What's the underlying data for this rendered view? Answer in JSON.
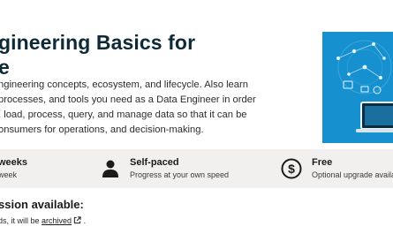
{
  "course": {
    "title_line1": "gineering Basics for",
    "title_line2": "e",
    "description_lines": [
      "ngineering concepts, ecosystem, and lifecycle. Also learn",
      "processes, and tools you need as a Data Engineer in order",
      ", load, process, query, and manage data so that it can be",
      "onsumers for operations, and decision-making."
    ]
  },
  "stats": {
    "duration": {
      "label": "weeks",
      "sub": "week"
    },
    "pace": {
      "icon": "person-icon",
      "label": "Self-paced",
      "sub": "Progress at your own speed"
    },
    "price": {
      "icon": "dollar-icon",
      "label": "Free",
      "sub": "Optional upgrade availab"
    }
  },
  "session": {
    "heading": "ssion available:",
    "text_before": "ds, it will be ",
    "archived_link": "archived",
    "text_after": " ."
  },
  "colors": {
    "hero_bg": "#1690cf",
    "title": "#0d2a36",
    "stats_bg": "#f2f0ef"
  }
}
